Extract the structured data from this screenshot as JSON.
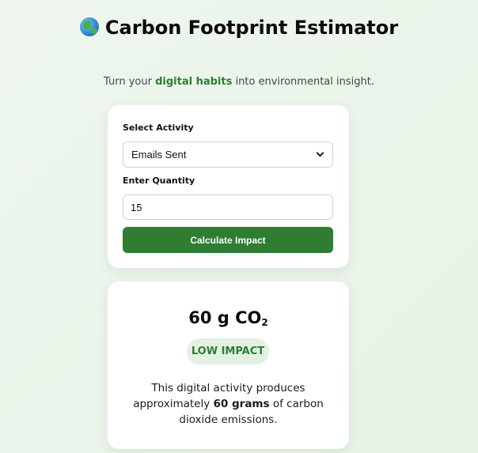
{
  "header": {
    "icon": "globe-icon",
    "title": "Carbon Footprint Estimator",
    "subtitle_prefix": "Turn your ",
    "subtitle_highlight": "digital habits",
    "subtitle_suffix": " into environmental insight."
  },
  "form": {
    "activity_label": "Select Activity",
    "activity_value": "Emails Sent",
    "quantity_label": "Enter Quantity",
    "quantity_value": "15",
    "submit_label": "Calculate Impact"
  },
  "result": {
    "amount": "60 g CO",
    "amount_subscript": "2",
    "impact_badge": "LOW IMPACT",
    "desc_prefix": "This digital activity produces approximately ",
    "desc_bold": "60 grams",
    "desc_suffix": " of carbon dioxide emissions."
  },
  "colors": {
    "accent": "#2e7d32",
    "badge_bg": "#e3f1e2",
    "page_bg": "#eef6ee"
  }
}
